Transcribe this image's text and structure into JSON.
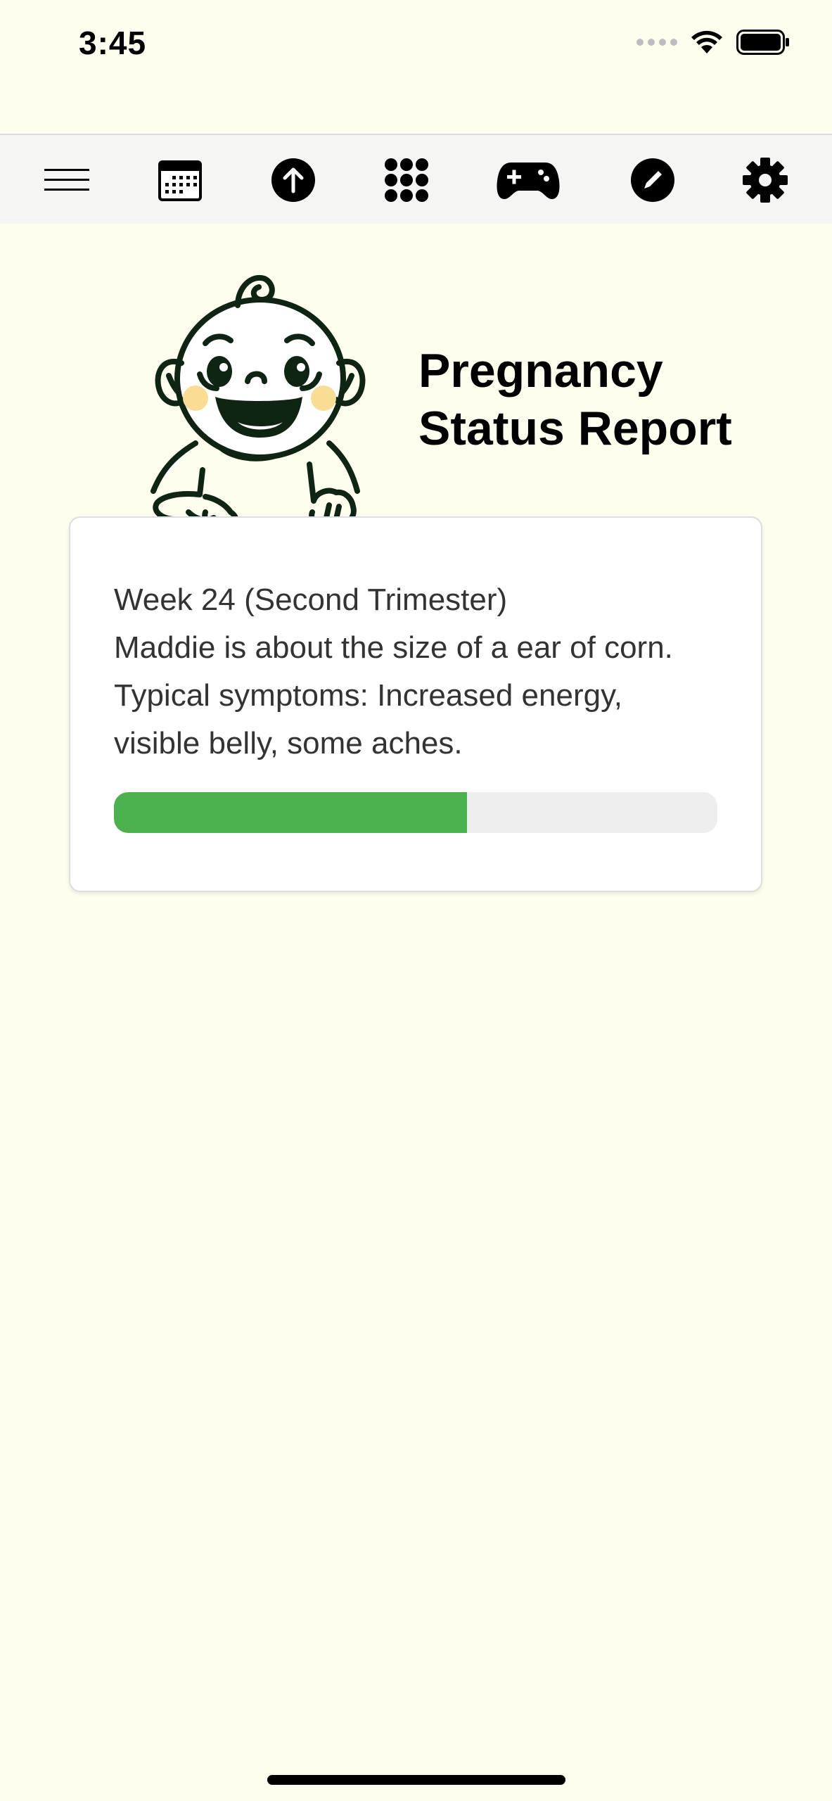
{
  "status_bar": {
    "time": "3:45",
    "icons": [
      "signal-dots-icon",
      "wifi-icon",
      "battery-icon"
    ]
  },
  "toolbar": {
    "items": [
      {
        "name": "menu",
        "icon": "hamburger-menu-icon"
      },
      {
        "name": "calendar",
        "icon": "calendar-icon"
      },
      {
        "name": "upload",
        "icon": "arrow-up-circle-icon"
      },
      {
        "name": "apps",
        "icon": "grid-dots-icon"
      },
      {
        "name": "games",
        "icon": "gamepad-icon"
      },
      {
        "name": "edit",
        "icon": "pencil-circle-icon"
      },
      {
        "name": "settings",
        "icon": "gear-icon"
      }
    ]
  },
  "hero": {
    "illustration": "baby-illustration",
    "title_line1": "Pregnancy",
    "title_line2": "Status Report"
  },
  "card": {
    "week": "Week 24 (Second Trimester)",
    "size_text": "Maddie is about the size of a ear of corn.",
    "symptoms_line1": "Typical symptoms: Increased energy,",
    "symptoms_line2": "visible belly, some aches.",
    "progress_fraction": 0.585
  },
  "colors": {
    "background": "#fefeee",
    "toolbar": "#f5f6f3",
    "progress": "#4caf50",
    "progress_track": "#eeeeee",
    "baby_outline": "#0f2412",
    "cheek": "#f9dd95"
  }
}
